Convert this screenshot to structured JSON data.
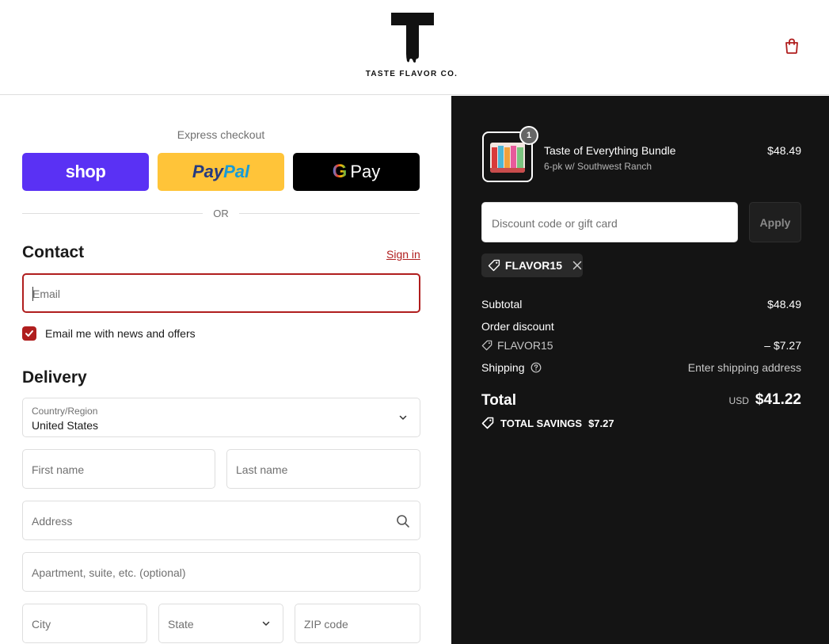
{
  "header": {
    "brand_name": "TASTE FLAVOR CO.",
    "cart_icon": "shopping-bag-icon"
  },
  "express": {
    "label": "Express checkout",
    "shop_label": "shop",
    "paypal_label_1": "Pay",
    "paypal_label_2": "Pal",
    "gpay_g": "G",
    "gpay_label": "Pay",
    "or_label": "OR"
  },
  "contact": {
    "title": "Contact",
    "signin_label": "Sign in",
    "email_placeholder": "Email",
    "newsletter_label": "Email me with news and offers",
    "newsletter_checked": true
  },
  "delivery": {
    "title": "Delivery",
    "country_label": "Country/Region",
    "country_value": "United States",
    "first_name_placeholder": "First name",
    "last_name_placeholder": "Last name",
    "address_placeholder": "Address",
    "apartment_placeholder": "Apartment, suite, etc. (optional)",
    "city_placeholder": "City",
    "state_placeholder": "State",
    "zip_placeholder": "ZIP code"
  },
  "summary": {
    "item": {
      "quantity": "1",
      "title": "Taste of Everything Bundle",
      "variant": "6-pk w/ Southwest Ranch",
      "price": "$48.49"
    },
    "discount_placeholder": "Discount code or gift card",
    "apply_label": "Apply",
    "applied_code": "FLAVOR15",
    "subtotal_label": "Subtotal",
    "subtotal_value": "$48.49",
    "order_discount_label": "Order discount",
    "discount_code_label": "FLAVOR15",
    "discount_value": "– $7.27",
    "shipping_label": "Shipping",
    "shipping_value": "Enter shipping address",
    "total_label": "Total",
    "currency": "USD",
    "total_value": "$41.22",
    "savings_label": "TOTAL SAVINGS",
    "savings_value": "$7.27"
  },
  "colors": {
    "accent": "#b01e1e",
    "shop": "#5a31f4",
    "paypal": "#ffc439",
    "summary_bg": "#141414"
  }
}
